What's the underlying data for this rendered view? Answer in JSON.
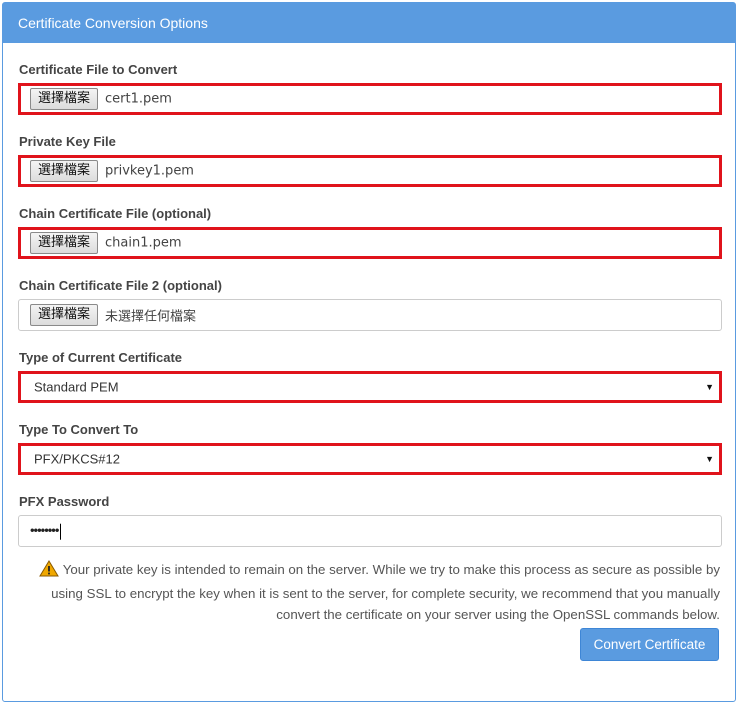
{
  "panel": {
    "title": "Certificate Conversion Options"
  },
  "fields": {
    "cert_file": {
      "label": "Certificate File to Convert",
      "button": "選擇檔案",
      "value": "cert1.pem"
    },
    "private_key": {
      "label": "Private Key File",
      "button": "選擇檔案",
      "value": "privkey1.pem"
    },
    "chain_file": {
      "label": "Chain Certificate File (optional)",
      "button": "選擇檔案",
      "value": "chain1.pem"
    },
    "chain_file2": {
      "label": "Chain Certificate File 2 (optional)",
      "button": "選擇檔案",
      "value": "未選擇任何檔案"
    },
    "current_type": {
      "label": "Type of Current Certificate",
      "value": "Standard PEM"
    },
    "convert_to": {
      "label": "Type To Convert To",
      "value": "PFX/PKCS#12"
    },
    "pfx_password": {
      "label": "PFX Password",
      "value": "••••••••"
    }
  },
  "notice": {
    "text": "Your private key is intended to remain on the server. While we try to make this process as secure as possible by using SSL to encrypt the key when it is sent to the server, for complete security, we recommend that you manually convert the certificate on your server using the OpenSSL commands below."
  },
  "actions": {
    "convert_label": "Convert Certificate"
  },
  "colors": {
    "accent": "#5a9be0",
    "highlight": "#e0131b",
    "warning": "#f0a800"
  }
}
